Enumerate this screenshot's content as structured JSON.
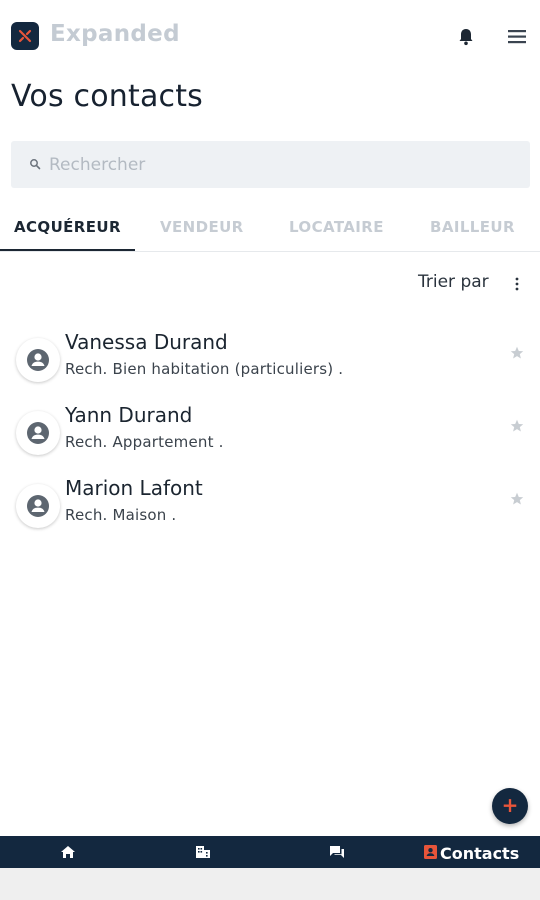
{
  "app": {
    "name": "Expanded"
  },
  "page": {
    "title": "Vos contacts"
  },
  "search": {
    "placeholder": "Rechercher",
    "value": ""
  },
  "tabs": [
    {
      "label": "ACQUÉREUR",
      "active": true
    },
    {
      "label": "VENDEUR",
      "active": false
    },
    {
      "label": "LOCATAIRE",
      "active": false
    },
    {
      "label": "BAILLEUR",
      "active": false
    }
  ],
  "sort": {
    "label": "Trier par"
  },
  "contacts": [
    {
      "name": "Vanessa Durand",
      "description": "Rech. Bien habitation (particuliers) ."
    },
    {
      "name": "Yann Durand",
      "description": "Rech. Appartement ."
    },
    {
      "name": "Marion Lafont",
      "description": "Rech. Maison ."
    }
  ],
  "fab": {
    "label": "+"
  },
  "bottom_nav": {
    "items": [
      {
        "icon": "home-icon"
      },
      {
        "icon": "building-icon"
      },
      {
        "icon": "chat-icon"
      },
      {
        "icon": "contacts-icon",
        "label": "Contacts",
        "active": true
      }
    ]
  },
  "colors": {
    "brand_navy": "#13283f",
    "accent_orange": "#e8553a",
    "muted_text": "#c6ccd3"
  }
}
